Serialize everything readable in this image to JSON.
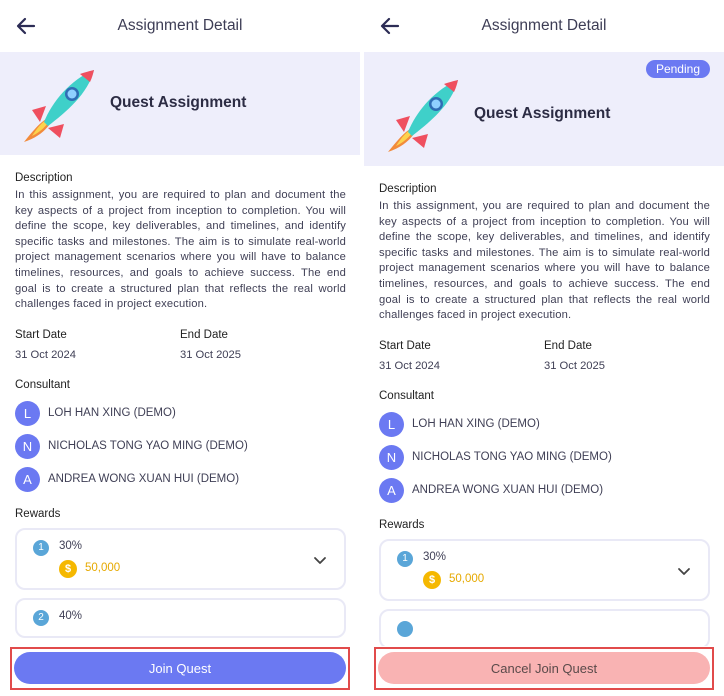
{
  "colors": {
    "accent": "#6b79f2",
    "hero_bg": "#eeeefb",
    "coin": "#f5b800",
    "cancel_bg": "#f9b3b3",
    "highlight": "#e14b4b"
  },
  "screens": [
    {
      "title": "Assignment Detail",
      "back_icon": "arrow-left-icon",
      "hero_title": "Quest Assignment",
      "labels": {
        "description": "Description",
        "start_date": "Start Date",
        "end_date": "End Date",
        "consultant": "Consultant",
        "rewards": "Rewards"
      },
      "description": "In this assignment, you are required to plan and document the key aspects of a project from inception to completion. You will define the scope, key deliverables, and timelines, and identify specific tasks and milestones. The aim is to simulate real-world project management scenarios where you will have to balance timelines, resources, and goals to achieve success. The end goal is to create a structured plan that reflects the real world challenges faced in project execution.",
      "start_date": "31 Oct 2024",
      "end_date": "31 Oct 2025",
      "consultants": [
        {
          "initial": "L",
          "name": "LOH HAN XING (DEMO)"
        },
        {
          "initial": "N",
          "name": "NICHOLAS TONG YAO MING (DEMO)"
        },
        {
          "initial": "A",
          "name": "ANDREA WONG XUAN HUI (DEMO)"
        }
      ],
      "rewards": [
        {
          "rank": "1",
          "percent": "30%",
          "amount": "50,000",
          "coin_symbol": "$"
        },
        {
          "rank": "2",
          "percent": "40%"
        }
      ],
      "action_label": "Join Quest"
    },
    {
      "title": "Assignment Detail",
      "back_icon": "arrow-left-icon",
      "hero_title": "Quest Assignment",
      "badge": "Pending",
      "labels": {
        "description": "Description",
        "start_date": "Start Date",
        "end_date": "End Date",
        "consultant": "Consultant",
        "rewards": "Rewards"
      },
      "description": "In this assignment, you are required to plan and document the key aspects of a project from inception to completion. You will define the scope, key deliverables, and timelines, and identify specific tasks and milestones. The aim is to simulate real-world project management scenarios where you will have to balance timelines, resources, and goals to achieve success. The end goal is to create a structured plan that reflects the real world challenges faced in project execution.",
      "start_date": "31 Oct 2024",
      "end_date": "31 Oct 2025",
      "consultants": [
        {
          "initial": "L",
          "name": "LOH HAN XING (DEMO)"
        },
        {
          "initial": "N",
          "name": "NICHOLAS TONG YAO MING (DEMO)"
        },
        {
          "initial": "A",
          "name": "ANDREA WONG XUAN HUI (DEMO)"
        }
      ],
      "rewards": [
        {
          "rank": "1",
          "percent": "30%",
          "amount": "50,000",
          "coin_symbol": "$"
        }
      ],
      "action_label": "Cancel Join Quest"
    }
  ]
}
